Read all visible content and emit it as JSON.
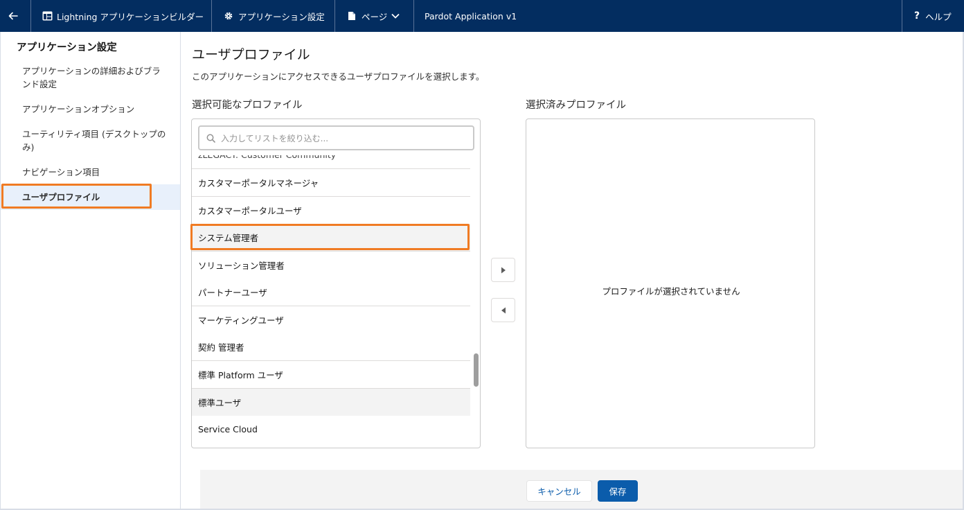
{
  "topbar": {
    "builder_label": "Lightning アプリケーションビルダー",
    "app_settings_label": "アプリケーション設定",
    "page_label": "ページ",
    "app_name": "Pardot Application v1",
    "help_label": "ヘルプ",
    "help_glyph": "?"
  },
  "sidebar": {
    "title": "アプリケーション設定",
    "items": [
      {
        "label": "アプリケーションの詳細およびブランド設定"
      },
      {
        "label": "アプリケーションオプション"
      },
      {
        "label": "ユーティリティ項目 (デスクトップのみ)"
      },
      {
        "label": "ナビゲーション項目"
      },
      {
        "label": "ユーザプロファイル"
      }
    ]
  },
  "main": {
    "title": "ユーザプロファイル",
    "description": "このアプリケーションにアクセスできるユーザプロファイルを選択します。",
    "available_label": "選択可能なプロファイル",
    "selected_label": "選択済みプロファイル",
    "search_placeholder": "入力してリストを絞り込む...",
    "available_profiles": [
      "zLEGACY: Customer Community",
      "カスタマーポータルマネージャ",
      "カスタマーポータルユーザ",
      "システム管理者",
      "ソリューション管理者",
      "パートナーユーザ",
      "マーケティングユーザ",
      "契約 管理者",
      "標準 Platform ユーザ",
      "標準ユーザ",
      "Service Cloud"
    ],
    "selected_empty_text": "プロファイルが選択されていません"
  },
  "footer": {
    "cancel_label": "キャンセル",
    "save_label": "保存"
  },
  "colors": {
    "topbar_bg": "#032d60",
    "highlight": "#f07b23",
    "brand_button": "#0b5cab",
    "active_item_bg": "#e8f0fb"
  }
}
